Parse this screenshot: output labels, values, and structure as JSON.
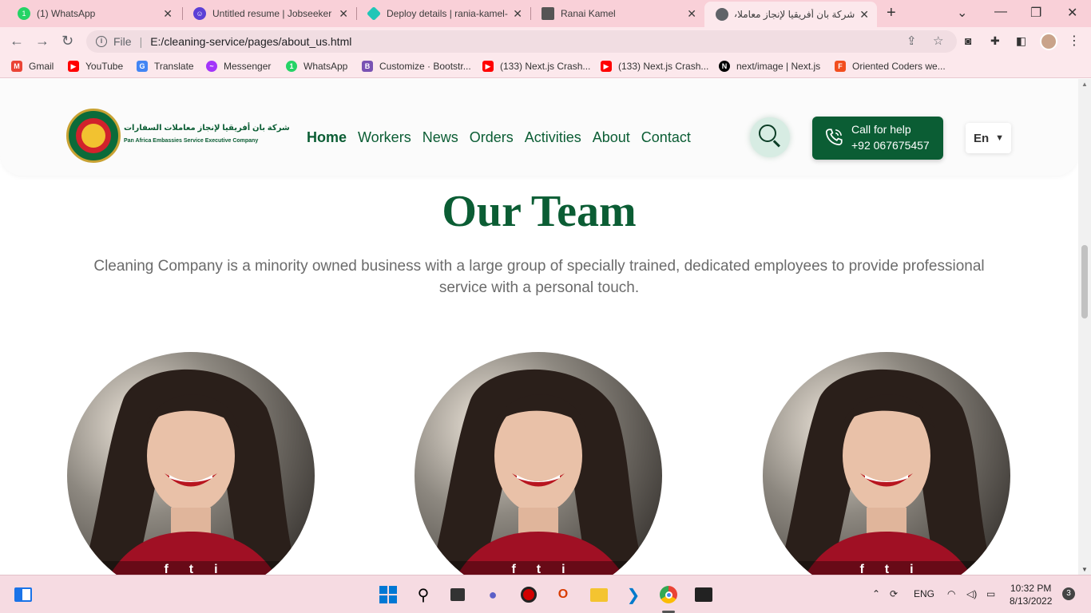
{
  "browser": {
    "tabs": [
      {
        "title": "(1) WhatsApp",
        "icon": "whatsapp-icon",
        "color": "#25d366",
        "badge": "1"
      },
      {
        "title": "Untitled resume | Jobseeker",
        "icon": "jobseeker-icon",
        "color": "#5b3fd6"
      },
      {
        "title": "Deploy details | rania-kamel-",
        "icon": "netlify-icon",
        "color": "#20c6b7"
      },
      {
        "title": "Ranai Kamel",
        "icon": "portfolio-icon",
        "color": "#555555"
      },
      {
        "title": "شركة بان أفريقيا لإنجاز معاملات",
        "icon": "globe-icon",
        "color": "#5f6368"
      }
    ],
    "url": {
      "scheme_label": "File",
      "path": "E:/cleaning-service/pages/about_us.html"
    },
    "bookmarks": [
      {
        "label": "Gmail",
        "icon": "gmail-icon",
        "color": "#ea4335",
        "glyph": "M"
      },
      {
        "label": "YouTube",
        "icon": "youtube-icon",
        "color": "#ff0000",
        "glyph": "▶"
      },
      {
        "label": "Translate",
        "icon": "translate-icon",
        "color": "#4285f4",
        "glyph": "G"
      },
      {
        "label": "Messenger",
        "icon": "messenger-icon",
        "color": "#a334fa",
        "glyph": "~"
      },
      {
        "label": "WhatsApp",
        "icon": "whatsapp-icon",
        "color": "#25d366",
        "glyph": "1"
      },
      {
        "label": "Customize · Bootstr...",
        "icon": "bootstrap-icon",
        "color": "#7952b3",
        "glyph": "B"
      },
      {
        "label": "(133) Next.js Crash...",
        "icon": "youtube-icon",
        "color": "#ff0000",
        "glyph": "▶"
      },
      {
        "label": "(133) Next.js Crash...",
        "icon": "youtube-icon",
        "color": "#ff0000",
        "glyph": "▶"
      },
      {
        "label": "next/image | Next.js",
        "icon": "nextjs-icon",
        "color": "#000000",
        "glyph": "N"
      },
      {
        "label": "Oriented Coders we...",
        "icon": "figma-icon",
        "color": "#f24e1e",
        "glyph": "F"
      }
    ]
  },
  "site": {
    "logo_ar": "شركة بان أفريقيا لإنجاز معاملات السفارات",
    "logo_en": "Pan Africa Embassies Service Executive Company",
    "nav": [
      "Home",
      "Workers",
      "News",
      "Orders",
      "Activities",
      "About",
      "Contact"
    ],
    "nav_active": "Home",
    "call": {
      "line1": "Call for help",
      "line2": "+92 067675457"
    },
    "lang": "En",
    "brand_color": "#0b5d34"
  },
  "team": {
    "title": "Our Team",
    "subtitle": "Cleaning Company is a minority owned business with a large group of specially trained, dedicated employees to provide professional service with a personal touch.",
    "members": [
      {
        "social": [
          "f",
          "t",
          "i"
        ]
      },
      {
        "social": [
          "f",
          "t",
          "i"
        ]
      },
      {
        "social": [
          "f",
          "t",
          "i"
        ]
      }
    ]
  },
  "taskbar": {
    "lang": "ENG",
    "time": "10:32 PM",
    "date": "8/13/2022",
    "notifications": "3"
  }
}
